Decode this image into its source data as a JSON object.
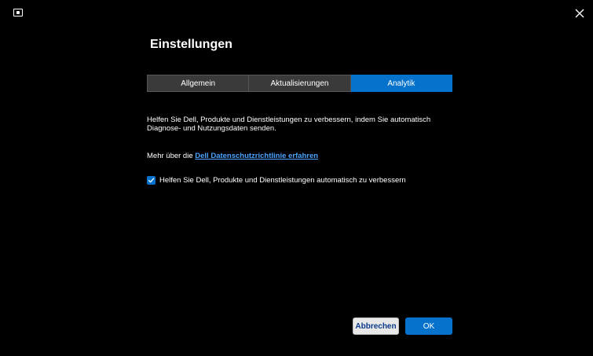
{
  "window": {
    "app_icon": "monitor-icon",
    "close_icon": "close-icon"
  },
  "title": "Einstellungen",
  "tabs": [
    {
      "label": "Allgemein",
      "active": false
    },
    {
      "label": "Aktualisierungen",
      "active": false
    },
    {
      "label": "Analytik",
      "active": true
    }
  ],
  "description": "Helfen Sie Dell, Produkte und Dienstleistungen zu verbessern, indem Sie automatisch Diagnose- und Nutzungsdaten senden.",
  "privacy": {
    "prefix": "Mehr über die ",
    "link_text": "Dell Datenschutzrichtlinie erfahren"
  },
  "checkbox": {
    "checked": true,
    "label": "Helfen Sie Dell, Produkte und Dienstleistungen automatisch zu verbessern"
  },
  "buttons": {
    "cancel": "Abbrechen",
    "ok": "OK"
  },
  "colors": {
    "accent": "#0672cb",
    "link": "#4aa3ff",
    "background": "#000000",
    "tab_inactive": "#3a3a3a"
  }
}
